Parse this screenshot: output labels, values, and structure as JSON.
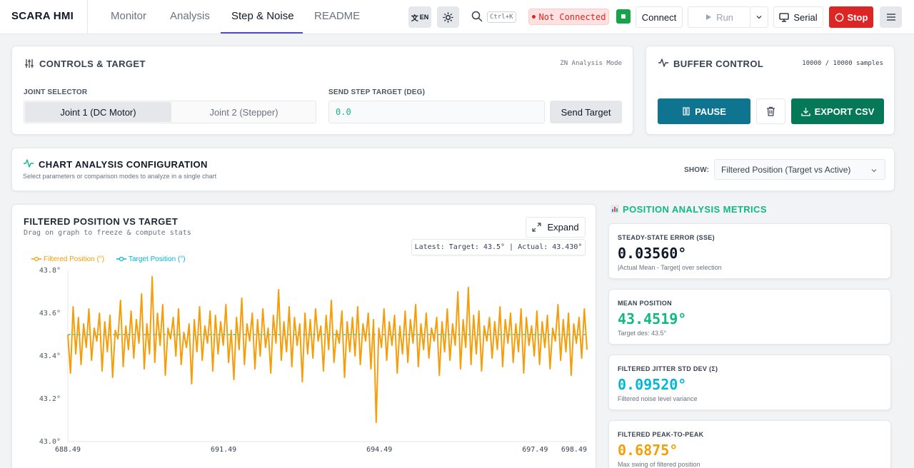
{
  "app": {
    "title": "SCARA HMI"
  },
  "nav": {
    "tabs": [
      "Monitor",
      "Analysis",
      "Step & Noise",
      "README"
    ],
    "active_tab": "Step & Noise"
  },
  "toolbar": {
    "lang_label": "EN",
    "search_shortcut": "Ctrl+K",
    "connection_status": "Not Connected",
    "connect_label": "Connect",
    "run_label": "Run",
    "serial_label": "Serial",
    "stop_label": "Stop"
  },
  "controls": {
    "title": "CONTROLS & TARGET",
    "mode": "ZN Analysis Mode",
    "joint_selector_label": "JOINT SELECTOR",
    "joint_options": [
      "Joint 1 (DC Motor)",
      "Joint 2 (Stepper)"
    ],
    "selected_joint": "Joint 1 (DC Motor)",
    "target_label": "SEND STEP TARGET (DEG)",
    "target_value": "0.0",
    "send_label": "Send Target"
  },
  "buffer": {
    "title": "BUFFER CONTROL",
    "samples": "10000 / 10000 samples",
    "pause_label": "PAUSE",
    "export_label": "EXPORT CSV"
  },
  "chart_config": {
    "title": "CHART ANALYSIS CONFIGURATION",
    "subtitle": "Select parameters or comparison modes to analyze in a single chart",
    "show_label": "SHOW:",
    "show_value": "Filtered Position (Target vs Active)"
  },
  "chart_panel": {
    "title": "FILTERED POSITION VS TARGET",
    "hint": "Drag on graph to freeze & compute stats",
    "expand_label": "Expand",
    "latest": "Latest: Target: 43.5° | Actual: 43.430°"
  },
  "metrics": {
    "title": "POSITION ANALYSIS METRICS",
    "items": [
      {
        "label": "STEADY-STATE ERROR (SSE)",
        "value": "0.03560°",
        "sub": "|Actual Mean - Target| over selection",
        "color": "#111827"
      },
      {
        "label": "MEAN POSITION",
        "value": "43.4519°",
        "sub": "Target des: 43.5°",
        "color": "#10b981"
      },
      {
        "label": "FILTERED JITTER STD DEV (Σ)",
        "value": "0.09520°",
        "sub": "Filtered noise level variance",
        "color": "#06b6d4"
      },
      {
        "label": "FILTERED PEAK-TO-PEAK",
        "value": "0.6875°",
        "sub": "Max swing of filtered position",
        "color": "#f59e0b"
      }
    ]
  },
  "chart_data": {
    "type": "line",
    "legend": [
      "Filtered Position (°)",
      "Target Position (°)"
    ],
    "colors": {
      "filtered": "#f59e0b",
      "target": "#06b6d4"
    },
    "y_ticks": [
      "43.8°",
      "43.6°",
      "43.4°",
      "43.2°",
      "43.0°"
    ],
    "x_ticks": [
      "688.49",
      "691.49",
      "694.49",
      "697.49",
      "698.49"
    ],
    "ylim": [
      43.0,
      43.8
    ],
    "xlim": [
      688.49,
      698.49
    ],
    "target_value": 43.5,
    "series": [
      {
        "name": "Filtered Position (°)",
        "values": [
          43.5,
          43.32,
          43.63,
          43.41,
          43.58,
          43.36,
          43.55,
          43.44,
          43.62,
          43.38,
          43.53,
          43.47,
          43.6,
          43.33,
          43.56,
          43.42,
          43.59,
          43.3,
          43.52,
          43.48,
          43.66,
          43.35,
          43.54,
          43.43,
          43.61,
          43.39,
          43.57,
          43.46,
          43.69,
          43.34,
          43.55,
          43.41,
          43.77,
          43.37,
          43.6,
          43.45,
          43.64,
          43.31,
          43.53,
          43.48,
          43.58,
          43.4,
          43.62,
          43.36,
          43.51,
          43.44,
          43.55,
          43.27,
          43.57,
          43.42,
          43.63,
          43.38,
          43.54,
          43.46,
          43.61,
          43.33,
          43.59,
          43.41,
          43.56,
          43.45,
          43.64,
          43.37,
          43.52,
          43.29,
          43.58,
          43.43,
          43.67,
          43.36,
          43.55,
          43.47,
          43.6,
          43.34,
          43.57,
          43.4,
          43.62,
          43.44,
          43.53,
          43.32,
          43.59,
          43.46,
          43.71,
          43.38,
          43.56,
          43.42,
          43.63,
          43.35,
          43.58,
          43.45,
          43.55,
          43.28,
          43.6,
          43.41,
          43.57,
          43.39,
          43.62,
          43.47,
          43.54,
          43.33,
          43.59,
          43.43,
          43.66,
          43.37,
          43.52,
          43.46,
          43.61,
          43.3,
          43.56,
          43.42,
          43.58,
          43.4,
          43.63,
          43.36,
          43.55,
          43.47,
          43.6,
          43.34,
          43.57,
          43.09,
          43.53,
          43.44,
          43.62,
          43.38,
          43.56,
          43.45,
          43.59,
          43.32,
          43.54,
          43.41,
          43.61,
          43.37,
          43.57,
          43.46,
          43.64,
          43.35,
          43.55,
          43.43,
          43.6,
          43.39,
          43.53,
          43.47,
          43.58,
          43.31,
          43.56,
          43.42,
          43.62,
          43.38,
          43.55,
          43.45,
          43.7,
          43.34,
          43.57,
          43.44,
          43.72,
          43.36,
          43.59,
          43.41,
          43.61,
          43.33,
          43.54,
          43.47,
          43.58,
          43.39,
          43.56,
          43.43,
          43.63,
          43.35,
          43.57,
          43.46,
          43.6,
          43.37,
          43.55,
          43.42,
          43.62,
          43.32,
          43.58,
          43.45,
          43.54,
          43.4,
          43.61,
          43.36,
          43.56,
          43.44,
          43.59,
          43.34,
          43.53,
          43.47,
          43.64,
          43.38,
          43.57,
          43.42,
          43.6,
          43.31,
          43.55,
          43.46,
          43.58,
          43.39,
          43.62,
          43.43
        ]
      },
      {
        "name": "Target Position (°)",
        "values": [
          43.5
        ]
      }
    ]
  }
}
